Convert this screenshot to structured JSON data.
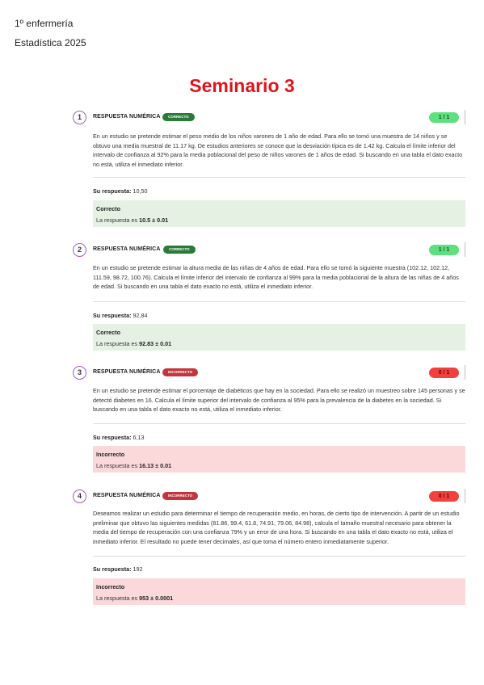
{
  "header": {
    "line1": "1º enfermería",
    "line2": "Estadística 2025"
  },
  "title": "Seminario 3",
  "questions": [
    {
      "number": "1",
      "type": "RESPUESTA NUMÉRICA",
      "badge": "CORRECTO",
      "score": "1 / 1",
      "text": "En un estudio se pretende estimar el peso medio de los niños varones de 1 año de edad. Para ello se tomó una muestra de 14 niños y se obtuvo una media muestral de 11.17 kg. De estudios anteriores se conoce que la desviación típica es de 1.42 kg. Calcula el límite inferior del intervalo de confianza al 92% para la media poblacional del peso de niños varones de 1 años de edad. Si buscando en una tabla el dato exacto no está, utiliza el inmediato inferior.",
      "answer_label": "Su respuesta:",
      "answer_value": "10,50",
      "feedback_title": "Correcto",
      "feedback_prefix": "La respuesta es",
      "feedback_value": "10.5 ± 0.01"
    },
    {
      "number": "2",
      "type": "RESPUESTA NUMÉRICA",
      "badge": "CORRECTO",
      "score": "1 / 1",
      "text": "En un estudio se pretende estimar la altura media de las niñas de 4 años de edad. Para ello se tomó la siguiente muestra (102.12, 102.12, 111.59, 98.72, 100.76). Calcula el límite inferior del intervalo de confianza al 99% para la media poblacional de la altura de las niñas de 4 años de edad. Si buscando en una tabla el dato exacto no está, utiliza el inmediato inferior.",
      "answer_label": "Su respuesta:",
      "answer_value": "92,84",
      "feedback_title": "Correcto",
      "feedback_prefix": "La respuesta es",
      "feedback_value": "92.83 ± 0.01"
    },
    {
      "number": "3",
      "type": "RESPUESTA NUMÉRICA",
      "badge": "INCORRECTO",
      "score": "0 / 1",
      "text": "En un estudio se pretende estimar el porcentaje de diabéticos que hay en la sociedad. Para ello se realizó un muestreo sobre 145 personas y se detectó diabetes en 16. Calcula el límite superior del intervalo de confianza al 95% para la prevalencia de la diabetes en la sociedad. Si buscando en una tabla el dato exacto no está, utiliza el inmediato inferior.",
      "answer_label": "Su respuesta:",
      "answer_value": "6,13",
      "feedback_title": "Incorrecto",
      "feedback_prefix": "La respuesta es",
      "feedback_value": "16.13 ± 0.01"
    },
    {
      "number": "4",
      "type": "RESPUESTA NUMÉRICA",
      "badge": "INCORRECTO",
      "score": "0 / 1",
      "text": "Deseamos realizar un estudio para determinar el tiempo de recuperación medio, en horas, de cierto tipo de intervención. A partir de un estudio preliminar que obtuvo las siguientes medidas (81.86, 99.4, 61.8, 74.91, 79.06, 84.98), calcula el tamaño muestral necesario para obtener la media del tiempo de recuperación con una confianza 79% y un error de una hora. Si buscando en una tabla el dato exacto no está, utiliza el inmediato inferior. El resultado no puede tener decimales, así que toma el número entero inmediatamente superior.",
      "answer_label": "Su respuesta:",
      "answer_value": "192",
      "feedback_title": "Incorrecto",
      "feedback_prefix": "La respuesta es",
      "feedback_value": "953 ± 0.0001"
    }
  ],
  "colors": {
    "title": "#e0141b",
    "correct_badge": "#2a7a38",
    "incorrect_badge": "#c4343d",
    "correct_score": "#5ee07e",
    "incorrect_score": "#f2403c",
    "correct_feedback_bg": "#e4f1e3",
    "incorrect_feedback_bg": "#fbd8da",
    "number_circle": "#a45bc6"
  }
}
